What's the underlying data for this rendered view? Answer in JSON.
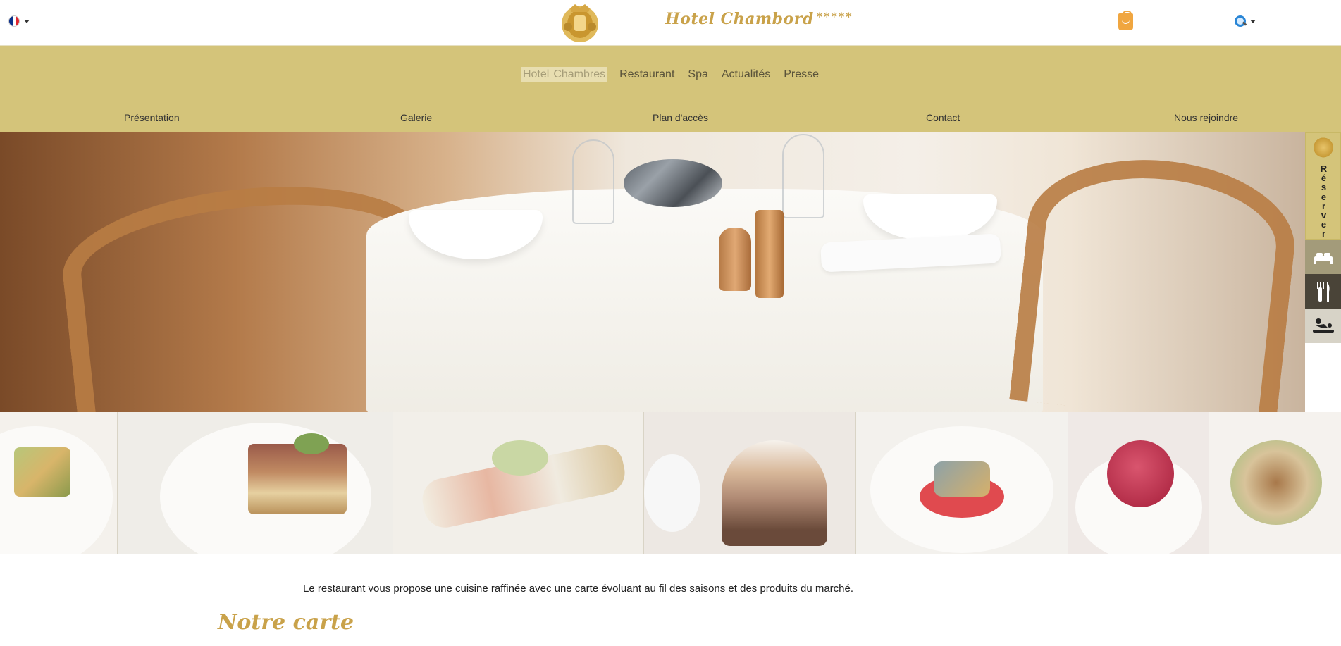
{
  "header": {
    "brand_name": "Hotel Chambord",
    "brand_stars": "*****",
    "language": {
      "icon": "flag-fr-icon",
      "flag_colors": [
        "#0a2f8a",
        "#ffffff",
        "#e0262f"
      ]
    },
    "cart_icon": "shopping-bag-icon",
    "search_icon": "search-icon"
  },
  "main_menu": {
    "items": [
      {
        "label": "Hotel"
      },
      {
        "label": "Chambres"
      },
      {
        "label": "Restaurant"
      },
      {
        "label": "Spa"
      },
      {
        "label": "Actualités"
      },
      {
        "label": "Presse"
      }
    ]
  },
  "sub_menu": {
    "items": [
      {
        "label": "Présentation"
      },
      {
        "label": "Galerie"
      },
      {
        "label": "Plan d'accès"
      },
      {
        "label": "Contact"
      },
      {
        "label": "Nous rejoindre"
      }
    ]
  },
  "side_widget": {
    "reserve_label": "Réserver",
    "reserve_letters": [
      "R",
      "é",
      "s",
      "e",
      "r",
      "v",
      "e",
      "r"
    ],
    "buttons": [
      {
        "icon": "bed-icon"
      },
      {
        "icon": "fork-knife-icon"
      },
      {
        "icon": "massage-icon"
      }
    ]
  },
  "content": {
    "intro": "Le restaurant vous propose une cuisine raffinée avec une carte évoluant au fil des saisons et des produits du marché.",
    "section_title": "Notre carte"
  },
  "colors": {
    "gold_nav": "#d4c47a",
    "brand_gold": "#c9a24a",
    "cart_orange": "#f0a640"
  }
}
